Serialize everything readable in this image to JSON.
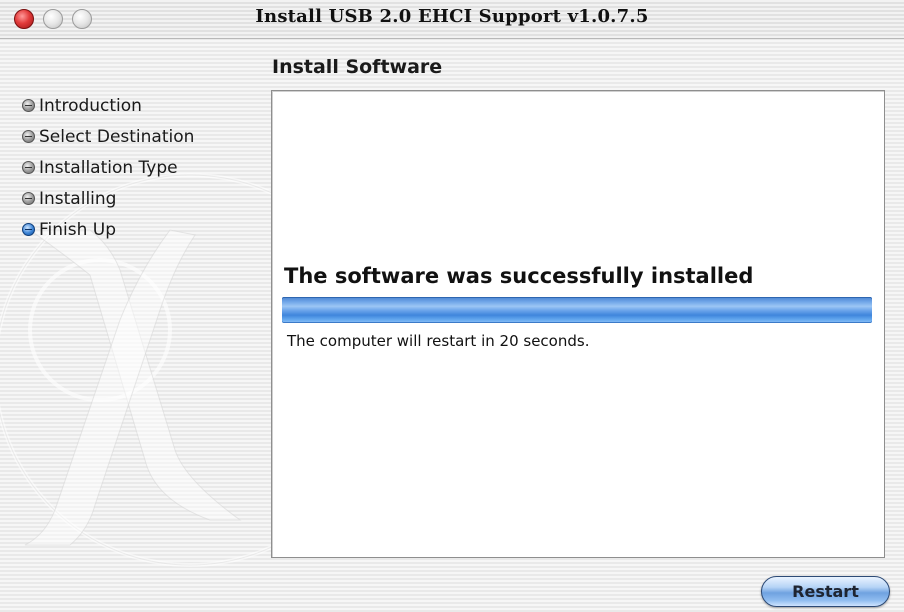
{
  "window": {
    "title": "Install USB 2.0 EHCI Support v1.0.7.5"
  },
  "sidebar": {
    "steps": [
      {
        "label": "Introduction",
        "active": false
      },
      {
        "label": "Select Destination",
        "active": false
      },
      {
        "label": "Installation Type",
        "active": false
      },
      {
        "label": "Installing",
        "active": false
      },
      {
        "label": "Finish Up",
        "active": true
      }
    ]
  },
  "main": {
    "section_title": "Install Software",
    "status_title": "The software was successfully installed",
    "progress": 1.0,
    "message": "The computer will restart in 20 seconds."
  },
  "buttons": {
    "restart_label": "Restart"
  },
  "colors": {
    "active_step_bullet": "#3c84d6",
    "progress_fill": "#6aa3ea",
    "close_button": "#e23b3b"
  },
  "icons": {
    "background": "mac-os-x-logo-watermark",
    "step_bullet": "step-bullet-icon"
  }
}
